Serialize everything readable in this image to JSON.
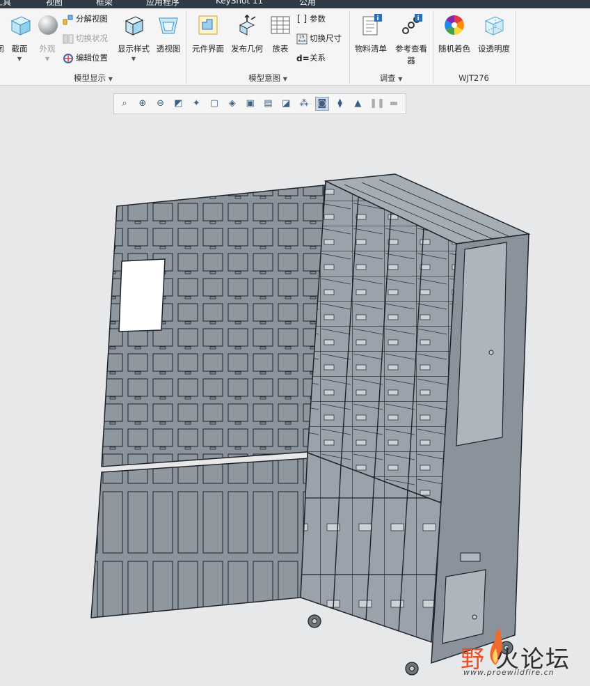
{
  "tabs": [
    {
      "id": "tools",
      "label": "工具"
    },
    {
      "id": "view",
      "label": "视图"
    },
    {
      "id": "frame",
      "label": "框架"
    },
    {
      "id": "apps",
      "label": "应用程序"
    },
    {
      "id": "keyshot",
      "label": "KeyShot 11"
    },
    {
      "id": "public",
      "label": "公用"
    }
  ],
  "groups": {
    "model_display": {
      "label": "模型显示",
      "buttons": {
        "cutoff": "闭",
        "section": "截面",
        "appearance": "外观",
        "explode": "分解视图",
        "toggle_state": "切换状况",
        "edit_position": "编辑位置",
        "display_style": "显示样式",
        "perspective": "透视图"
      }
    },
    "model_intent": {
      "label": "模型意图",
      "buttons": {
        "component_interface": "元件界面",
        "publish_geometry": "发布几何",
        "family_table": "族表",
        "parameters": "参数",
        "switch_dimensions": "切换尺寸",
        "relations": "关系"
      }
    },
    "investigate": {
      "label": "调查",
      "buttons": {
        "bom": "物料清单",
        "reference_viewer_line1": "参考查看",
        "reference_viewer_line2": "器"
      }
    },
    "wjt": {
      "label": "WJT276",
      "buttons": {
        "random_color": "随机着色",
        "set_transparency": "设透明度"
      }
    }
  },
  "view_toolbar": [
    "zoom-fit-icon",
    "zoom-in-icon",
    "zoom-out-icon",
    "repaint-icon",
    "spin-center-icon",
    "named-views-icon",
    "view-manager-icon",
    "display-style-icon",
    "saved-orientations-icon",
    "annotation-display-icon",
    "datum-display-icon",
    "spin-icon",
    "connections-icon",
    "appearance-icon",
    "pause-icon",
    "tool-icon"
  ],
  "colors": {
    "accent": "#2f6db5",
    "ribbon_bg": "#f5f5f5",
    "viewport_bg": "#e7e8ea",
    "model_face": "#8a929b",
    "model_edge": "#1f2328"
  },
  "watermark": {
    "cn_part1": "野",
    "cn_part2": "火论坛",
    "url": "www.proewildfire.cn"
  }
}
